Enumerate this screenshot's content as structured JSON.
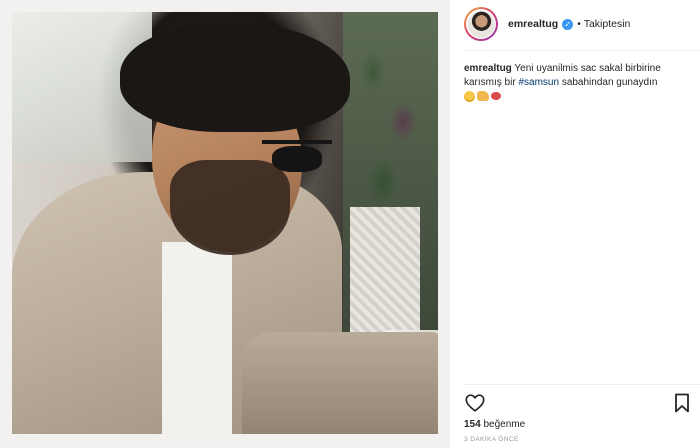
{
  "post": {
    "username": "emrealtug",
    "follow_status": "Takiptesin",
    "dot": "•",
    "caption_user": "emrealtug",
    "caption_text_1": "Yeni uyanilmis sac sakal birbirine karısmış bir",
    "hashtag": "#samsun",
    "caption_text_2": "sabahindan gunaydın",
    "emojis": [
      "smiling-face",
      "flexed-arm",
      "kiss-mark"
    ],
    "likes_count": "154",
    "likes_label": "beğenme",
    "timestamp": "3 DAKİKA ÖNCE"
  },
  "colors": {
    "verified": "#3897f0",
    "hashtag": "#003569",
    "text": "#262626",
    "muted": "#999999"
  },
  "icons": {
    "verified": "verified-badge-icon",
    "like": "heart-outline-icon",
    "save": "bookmark-outline-icon"
  }
}
